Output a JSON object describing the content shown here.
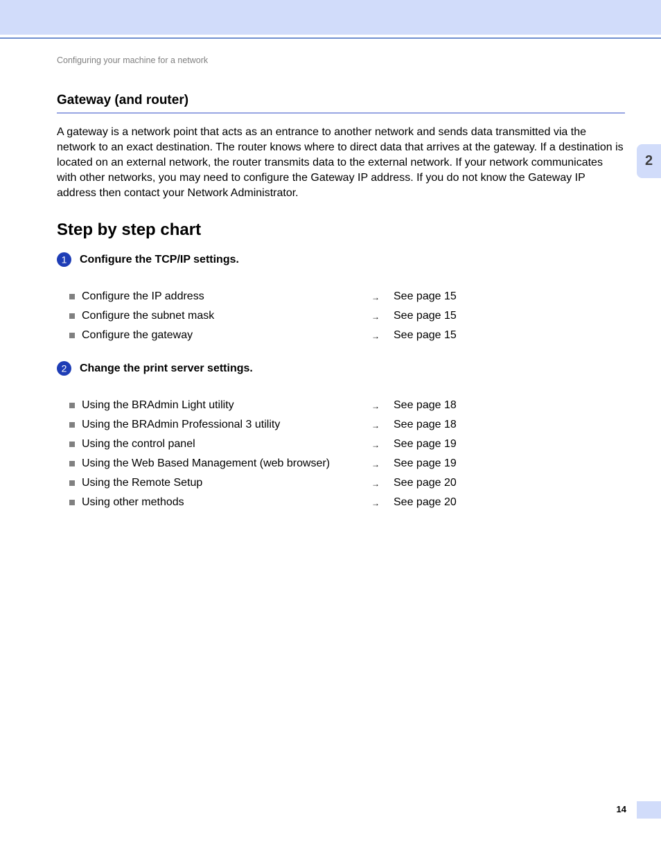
{
  "header": {
    "breadcrumb": "Configuring your machine for a network",
    "chapter_tab": "2"
  },
  "section": {
    "title": "Gateway (and router)",
    "paragraph": "A gateway is a network point that acts as an entrance to another network and sends data transmitted via the network to an exact destination. The router knows where to direct data that arrives at the gateway. If a destination is located on an external network, the router transmits data to the external network. If your network communicates with other networks, you may need to configure the Gateway IP address. If you do not know the Gateway IP address then contact your Network Administrator."
  },
  "chart": {
    "heading": "Step by step chart",
    "arrow": "→",
    "steps": [
      {
        "number": "1",
        "title": "Configure the TCP/IP settings.",
        "items": [
          {
            "label": "Configure the IP address",
            "ref": "See page 15"
          },
          {
            "label": "Configure the subnet mask",
            "ref": "See page 15"
          },
          {
            "label": "Configure the gateway",
            "ref": "See page 15"
          }
        ]
      },
      {
        "number": "2",
        "title": "Change the print server settings.",
        "items": [
          {
            "label": "Using the BRAdmin Light utility",
            "ref": "See page 18"
          },
          {
            "label": "Using the BRAdmin Professional 3 utility",
            "ref": "See page 18"
          },
          {
            "label": "Using the control panel",
            "ref": "See page 19"
          },
          {
            "label": "Using the Web Based Management (web browser)",
            "ref": "See page 19"
          },
          {
            "label": "Using the Remote Setup",
            "ref": "See page 20"
          },
          {
            "label": "Using other methods",
            "ref": "See page 20"
          }
        ]
      }
    ]
  },
  "footer": {
    "page_number": "14"
  }
}
